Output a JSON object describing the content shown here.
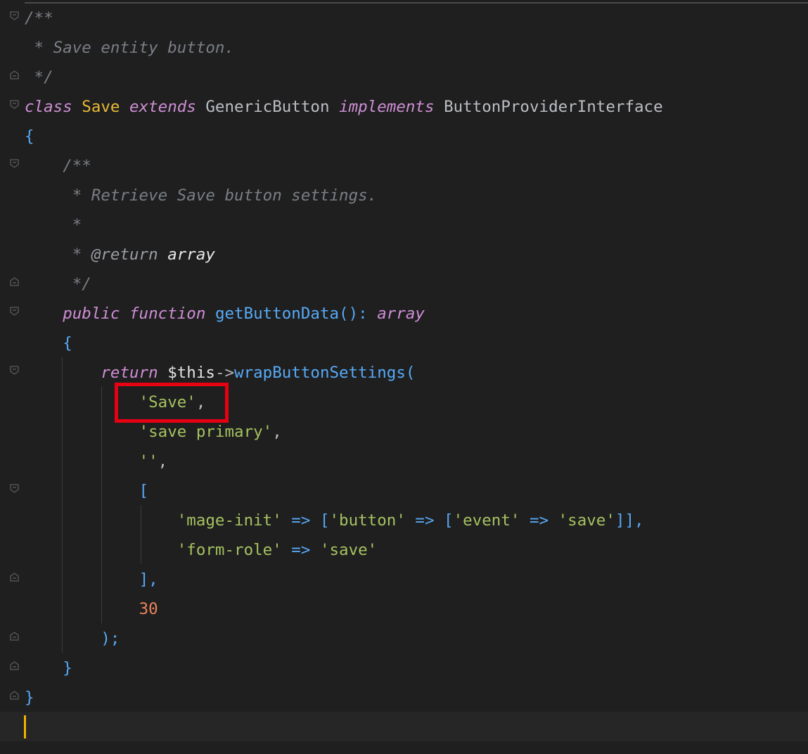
{
  "code": {
    "l1_comment_open": "/**",
    "l2_comment": " * Save entity button.",
    "l3_comment_close": " */",
    "l4_class_kw": "class",
    "l4_class_name": "Save",
    "l4_extends_kw": "extends",
    "l4_parent": "GenericButton",
    "l4_implements_kw": "implements",
    "l4_interface": "ButtonProviderInterface",
    "l5_brace": "{",
    "l6_comment_open": "/**",
    "l7_comment": " * Retrieve Save button settings.",
    "l8_comment": " *",
    "l9_comment_prefix": " * ",
    "l9_return_tag": "@return",
    "l9_return_type": "array",
    "l10_comment_close": " */",
    "l11_public_kw": "public",
    "l11_function_kw": "function",
    "l11_fn_name": "getButtonData",
    "l11_parens": "():",
    "l11_return_type": "array",
    "l12_brace": "{",
    "l13_return_kw": "return",
    "l13_this": "$this",
    "l13_arrow": "->",
    "l13_method": "wrapButtonSettings",
    "l13_paren": "(",
    "l14_str": "'Save'",
    "l14_comma": ",",
    "l15_str": "'save primary'",
    "l15_comma": ",",
    "l16_str": "''",
    "l16_comma": ",",
    "l17_bracket": "[",
    "l18_key": "'mage-init'",
    "l18_op1": " => ",
    "l18_open1": "[",
    "l18_key2": "'button'",
    "l18_op2": " => ",
    "l18_open2": "[",
    "l18_key3": "'event'",
    "l18_op3": " => ",
    "l18_val3": "'save'",
    "l18_close": "]],",
    "l19_key": "'form-role'",
    "l19_op": " => ",
    "l19_val": "'save'",
    "l20_bracket": "],",
    "l21_num": "30",
    "l22_close": ");",
    "l23_brace": "}",
    "l24_brace": "}"
  },
  "colors": {
    "background": "#1f1f1f",
    "comment": "#7a7e85",
    "keyword": "#cf8ed6",
    "class_name": "#e8ba36",
    "string": "#a5c261",
    "number": "#e8855d",
    "function": "#57aaf7",
    "highlight_box": "#e60012",
    "caret": "#f0b400"
  }
}
